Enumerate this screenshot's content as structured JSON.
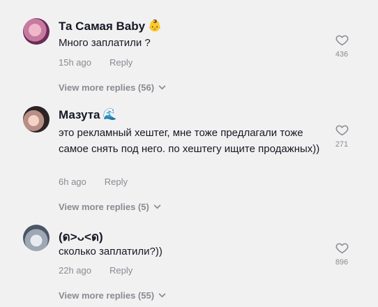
{
  "comments": [
    {
      "username": "Та Самая Baby",
      "badge_icon": "baby-face-icon",
      "text": "Много заплатили ?",
      "time": "15h ago",
      "reply_label": "Reply",
      "likes": "436",
      "more_replies": "View more replies (56)"
    },
    {
      "username": "Мазута",
      "badge_icon": "wave-icon",
      "text": "это рекламный хештег, мне тоже предлагали тоже самое снять под него. по хештегу ищите продажных))",
      "time": "6h ago",
      "reply_label": "Reply",
      "likes": "271",
      "more_replies": "View more replies (5)"
    },
    {
      "username": "(ด>ᴗ<ด)",
      "text": "сколько заплатили?))",
      "time": "22h ago",
      "reply_label": "Reply",
      "likes": "896",
      "more_replies": "View more replies (55)"
    }
  ]
}
